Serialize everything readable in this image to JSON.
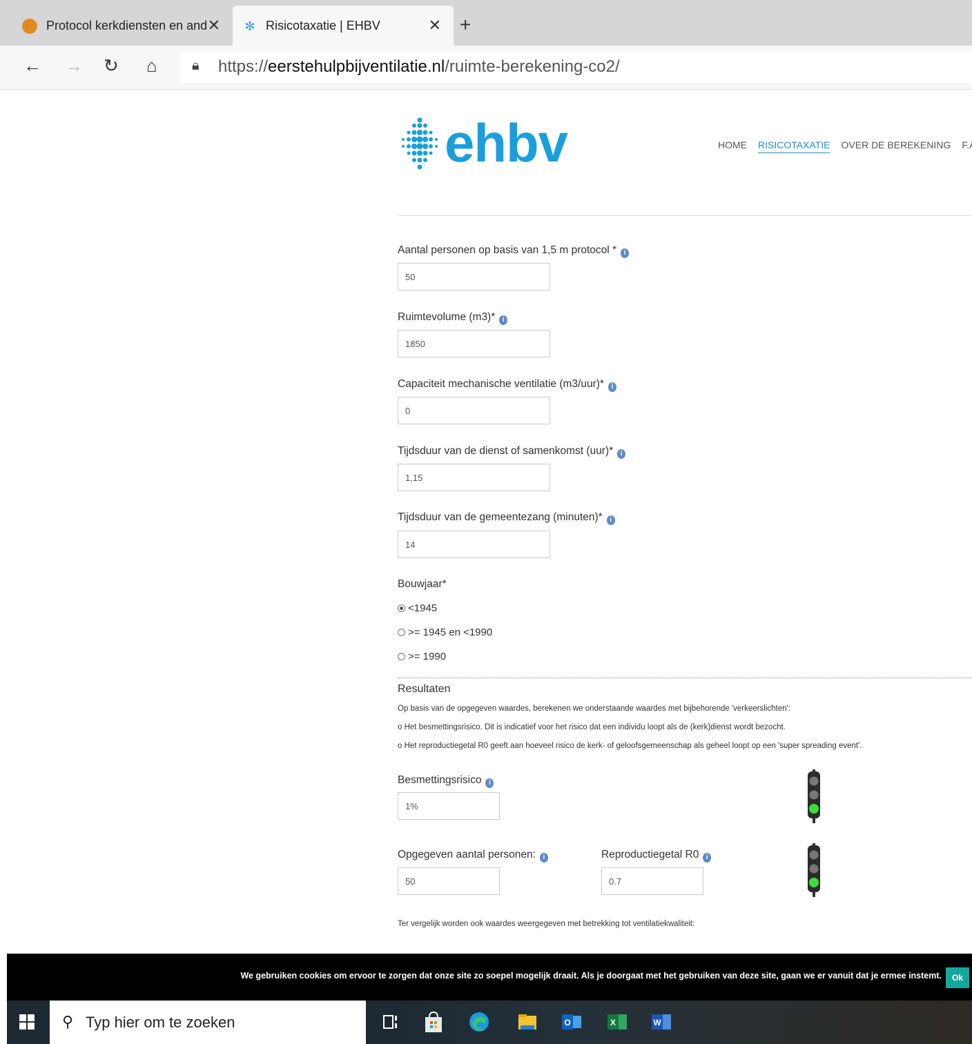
{
  "browser": {
    "tabs": [
      {
        "title": "Protocol kerkdiensten en andere",
        "active": false
      },
      {
        "title": "Risicotaxatie | EHBV",
        "active": true
      }
    ],
    "url_prefix": "https://",
    "url_domain": "eerstehulpbijventilatie.nl",
    "url_path": "/ruimte-berekening-co2/"
  },
  "site": {
    "logo_text": "ehbv",
    "nav": [
      "HOME",
      "RISICOTAXATIE",
      "OVER DE BEREKENING",
      "F.A.Q."
    ],
    "nav_active": "RISICOTAXATIE",
    "brand_color": "#1a9fdc"
  },
  "form": {
    "personen": {
      "label": "Aantal personen op basis van 1,5 m protocol *",
      "value": "50"
    },
    "volume": {
      "label": "Ruimtevolume (m3)*",
      "value": "1850"
    },
    "ventilatie": {
      "label": "Capaciteit mechanische ventilatie (m3/uur)*",
      "value": "0"
    },
    "tijdsduur": {
      "label": "Tijdsduur van de dienst of samenkomst (uur)*",
      "value": "1,15"
    },
    "zang": {
      "label": "Tijdsduur van de gemeentezang (minuten)*",
      "value": "14"
    },
    "bouwjaar": {
      "label": "Bouwjaar*",
      "options": [
        "<1945",
        ">= 1945 en <1990",
        ">= 1990"
      ],
      "selected": "<1945"
    }
  },
  "results": {
    "title": "Resultaten",
    "lines": [
      "Op basis van de opgegeven waardes, berekenen we onderstaande waardes met bijbehorende 'verkeerslichten':",
      "o Het besmettingsrisico. Dit is indicatief voor het risico dat een individu loopt als de (kerk)dienst wordt bezocht.",
      "o Het reproductiegetal R0 geeft aan hoeveel risico de kerk- of geloofsgemeenschap als geheel loopt op een 'super spreading event'."
    ],
    "besmetting": {
      "label": "Besmettingsrisico",
      "value": "1%",
      "light": "green"
    },
    "opgegeven": {
      "label": "Opgegeven aantal personen:",
      "value": "50"
    },
    "r0": {
      "label": "Reproductiegetal R0",
      "value": "0.7",
      "light": "green"
    },
    "compare_text": "Ter vergelijk worden ook waardes weergegeven met betrekking tot ventilatiekwaliteit:"
  },
  "cookie": {
    "text": "We gebruiken cookies om ervoor te zorgen dat onze site zo soepel mogelijk draait. Als je doorgaat met het gebruiken van deze site, gaan we er vanuit dat je ermee instemt.",
    "ok_label": "Ok"
  },
  "taskbar": {
    "search_placeholder": "Typ hier om te zoeken",
    "apps": [
      "task-view",
      "store",
      "edge",
      "file-explorer",
      "outlook",
      "excel",
      "word"
    ]
  }
}
